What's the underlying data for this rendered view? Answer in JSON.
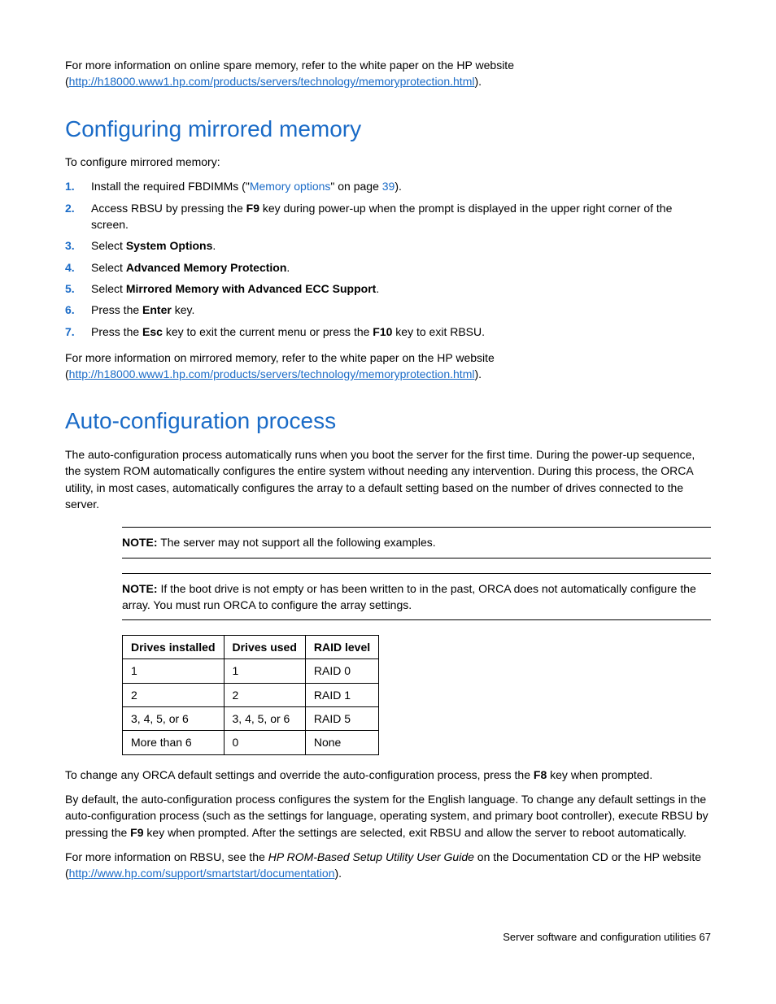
{
  "intro": {
    "text_before_link": "For more information on online spare memory, refer to the white paper on the HP website (",
    "link": "http://h18000.www1.hp.com/products/servers/technology/memoryprotection.html",
    "text_after_link": ")."
  },
  "section1": {
    "heading": "Configuring mirrored memory",
    "lead": "To configure mirrored memory:",
    "steps": [
      {
        "num": "1.",
        "pre": "Install the required FBDIMMs (\"",
        "xref": "Memory options",
        "mid": "\" on page ",
        "page": "39",
        "post": ")."
      },
      {
        "num": "2.",
        "pre": "Access RBSU by pressing the ",
        "b1": "F9",
        "post": " key during power-up when the prompt is displayed in the upper right corner of the screen."
      },
      {
        "num": "3.",
        "pre": "Select ",
        "b1": "System Options",
        "post": "."
      },
      {
        "num": "4.",
        "pre": "Select ",
        "b1": "Advanced Memory Protection",
        "post": "."
      },
      {
        "num": "5.",
        "pre": "Select ",
        "b1": "Mirrored Memory with Advanced ECC Support",
        "post": "."
      },
      {
        "num": "6.",
        "pre": "Press the ",
        "b1": "Enter",
        "post": " key."
      },
      {
        "num": "7.",
        "pre": "Press the ",
        "b1": "Esc",
        "mid": " key to exit the current menu or press the ",
        "b2": "F10",
        "post": " key to exit RBSU."
      }
    ],
    "outro_before": "For more information on mirrored memory, refer to the white paper on the HP website (",
    "outro_link": "http://h18000.www1.hp.com/products/servers/technology/memoryprotection.html",
    "outro_after": ")."
  },
  "section2": {
    "heading": "Auto-configuration process",
    "p1": "The auto-configuration process automatically runs when you boot the server for the first time. During the power-up sequence, the system ROM automatically configures the entire system without needing any intervention. During this process, the ORCA utility, in most cases, automatically configures the array to a default setting based on the number of drives connected to the server.",
    "note1_label": "NOTE:",
    "note1_text": "  The server may not support all the following examples.",
    "note2_label": "NOTE:",
    "note2_text": "  If the boot drive is not empty or has been written to in the past, ORCA does not automatically configure the array. You must run ORCA to configure the array settings.",
    "table": {
      "headers": [
        "Drives installed",
        "Drives used",
        "RAID level"
      ],
      "rows": [
        [
          "1",
          "1",
          "RAID 0"
        ],
        [
          "2",
          "2",
          "RAID 1"
        ],
        [
          "3, 4, 5, or 6",
          "3, 4, 5, or 6",
          "RAID 5"
        ],
        [
          "More than 6",
          "0",
          "None"
        ]
      ]
    },
    "p2_pre": "To change any ORCA default settings and override the auto-configuration process, press the ",
    "p2_b": "F8",
    "p2_post": " key when prompted.",
    "p3_pre": "By default, the auto-configuration process configures the system for the English language. To change any default settings in the auto-configuration process (such as the settings for language, operating system, and primary boot controller), execute RBSU by pressing the ",
    "p3_b": "F9",
    "p3_post": " key when prompted. After the settings are selected, exit RBSU and allow the server to reboot automatically.",
    "p4_pre": "For more information on RBSU, see the ",
    "p4_italic": "HP ROM-Based Setup Utility User Guide",
    "p4_mid": " on the Documentation CD or the HP website (",
    "p4_link": "http://www.hp.com/support/smartstart/documentation",
    "p4_post": ")."
  },
  "footer": {
    "text": "Server software and configuration utilities   67"
  }
}
